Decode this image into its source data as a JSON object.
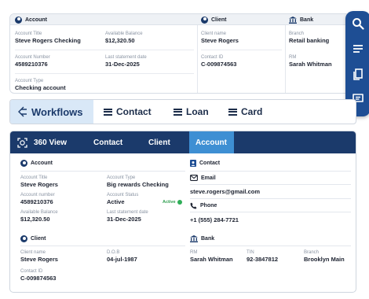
{
  "top_card": {
    "account": {
      "title": "Account",
      "fields": [
        {
          "label": "Account Title",
          "value": "Steve Rogers Checking"
        },
        {
          "label": "Available Balance",
          "value": "$12,320.50"
        },
        {
          "label": "Account Number",
          "value": "4589210376"
        },
        {
          "label": "Last statement date",
          "value": "31-Dec-2025"
        },
        {
          "label": "Account Type",
          "value": "Checking account"
        }
      ]
    },
    "client": {
      "title": "Client",
      "fields": [
        {
          "label": "Client name",
          "value": "Steve Rogers"
        },
        {
          "label": "Contact ID",
          "value": "C-009874563"
        }
      ]
    },
    "bank": {
      "title": "Bank",
      "fields": [
        {
          "label": "Branch",
          "value": "Retail banking"
        },
        {
          "label": "RM",
          "value": "Sarah Whitman"
        }
      ]
    }
  },
  "toolbar": {
    "icons": [
      "search-icon",
      "menu-icon",
      "copy-icon",
      "message-icon"
    ]
  },
  "workflow_tabs": {
    "items": [
      {
        "label": "Workflows",
        "icon": "workflow-icon"
      },
      {
        "label": "Contact",
        "icon": "hamburger-icon"
      },
      {
        "label": "Loan",
        "icon": "hamburger-icon"
      },
      {
        "label": "Card",
        "icon": "hamburger-icon"
      }
    ]
  },
  "view360": {
    "title": "360 View",
    "tabs": [
      "Contact",
      "Client",
      "Account"
    ],
    "active_tab": "Account",
    "account": {
      "title": "Account",
      "fields": [
        {
          "label": "Account Title",
          "value": "Steve Rogers"
        },
        {
          "label": "Account Type",
          "value": "Big rewards Checking"
        },
        {
          "label": "Account number",
          "value": "4589210376"
        },
        {
          "label": "Account Status",
          "value": "Active"
        },
        {
          "label": "Available Balance",
          "value": "$12,320.50"
        },
        {
          "label": "Last statement date",
          "value": "31-Dec-2025"
        }
      ],
      "status_badge": "Active"
    },
    "client": {
      "title": "Client",
      "fields": [
        {
          "label": "Client name",
          "value": "Steve Rogers"
        },
        {
          "label": "D.O.B",
          "value": "04-jul-1987"
        },
        {
          "label": "Contact ID",
          "value": "C-009874563"
        }
      ]
    },
    "contact": {
      "title": "Contact",
      "email_label": "Email",
      "email": "steve.rogers@gmail.com",
      "phone_label": "Phone",
      "phone": "+1 (555) 284-7721"
    },
    "bank": {
      "title": "Bank",
      "fields": [
        {
          "label": "RM",
          "value": "Sarah Whitman"
        },
        {
          "label": "TIN",
          "value": "92-3847812"
        },
        {
          "label": "Branch",
          "value": "Brooklyn Main"
        }
      ]
    }
  },
  "colors": {
    "navy": "#1b3a6b",
    "accent_blue": "#3e8fd3",
    "toolbar_blue": "#1e4e94",
    "active_green": "#2fae58",
    "tab_highlight": "#d9e8f7"
  }
}
